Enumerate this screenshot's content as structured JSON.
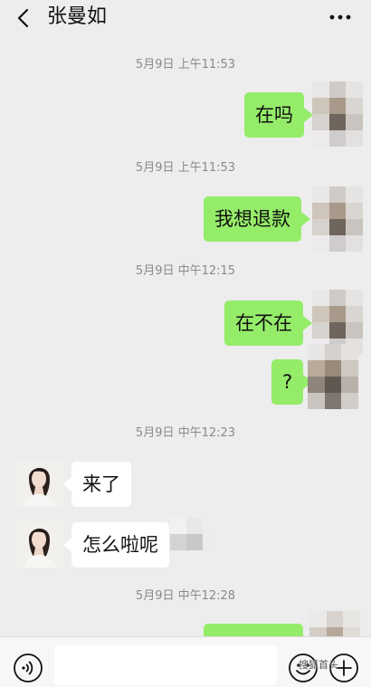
{
  "header": {
    "title": "张曼如",
    "back_icon": "chevron-left-icon",
    "more_icon": "more-dots-icon"
  },
  "messages": [
    {
      "type": "time",
      "text": "5月9日 上午11:53"
    },
    {
      "type": "outgoing",
      "text": "在吗"
    },
    {
      "type": "time",
      "text": "5月9日 上午11:53"
    },
    {
      "type": "outgoing",
      "text": "我想退款"
    },
    {
      "type": "time",
      "text": "5月9日 中午12:15"
    },
    {
      "type": "outgoing",
      "text": "在不在"
    },
    {
      "type": "outgoing",
      "text": "?"
    },
    {
      "type": "time",
      "text": "5月9日 中午12:23"
    },
    {
      "type": "incoming",
      "text": "来了"
    },
    {
      "type": "incoming",
      "text": "怎么啦呢"
    },
    {
      "type": "time",
      "text": "5月9日 中午12:28"
    },
    {
      "type": "outgoing",
      "text": ""
    }
  ],
  "input_bar": {
    "voice_icon": "voice-icon",
    "emoji_icon": "emoji-icon",
    "plus_icon": "plus-circle-icon",
    "input_value": ""
  },
  "colors": {
    "background": "#ededed",
    "outgoing_bubble": "#95ec69",
    "incoming_bubble": "#ffffff",
    "timestamp_text": "#8a8a8a"
  },
  "watermark": "搜狐首头"
}
